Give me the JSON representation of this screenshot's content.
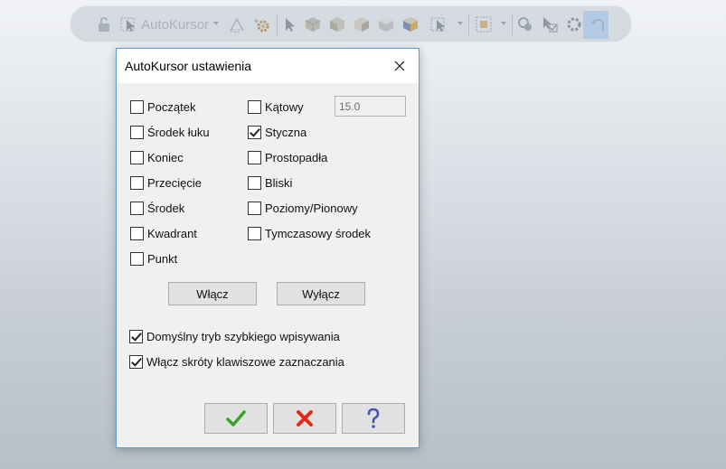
{
  "dialog": {
    "title": "AutoKursor ustawienia",
    "angle_value": "15.0",
    "options_left": [
      {
        "label": "Początek",
        "checked": false
      },
      {
        "label": "Środek łuku",
        "checked": false
      },
      {
        "label": "Koniec",
        "checked": false
      },
      {
        "label": "Przecięcie",
        "checked": false
      },
      {
        "label": "Środek",
        "checked": false
      },
      {
        "label": "Kwadrant",
        "checked": false
      },
      {
        "label": "Punkt",
        "checked": false
      }
    ],
    "options_right": [
      {
        "label": "Kątowy",
        "checked": false
      },
      {
        "label": "Styczna",
        "checked": true
      },
      {
        "label": "Prostopadła",
        "checked": false
      },
      {
        "label": "Bliski",
        "checked": false
      },
      {
        "label": "Poziomy/Pionowy",
        "checked": false
      },
      {
        "label": "Tymczasowy środek",
        "checked": false
      }
    ],
    "enable_all_label": "Włącz",
    "disable_all_label": "Wyłącz",
    "bottom_options": [
      {
        "label": "Domyślny tryb szybkiego wpisywania",
        "checked": true
      },
      {
        "label": "Włącz skróty klawiszowe zaznaczania",
        "checked": true
      }
    ]
  },
  "toolbar": {
    "autokursor_label": "AutoKursor",
    "icons": [
      "lock-icon",
      "autokursor-icon",
      "xyz-icon",
      "settings-icon",
      "pointer-icon",
      "view-icons",
      "selection-icon",
      "select-box-icon",
      "snap-icon",
      "select-check-icon",
      "refresh-icon",
      "undo-pointer-icon"
    ]
  },
  "colors": {
    "ok_green": "#3aa32b",
    "cancel_red": "#e02a1e",
    "help_blue": "#4a57a8",
    "dialog_border": "#5d9ad6"
  }
}
